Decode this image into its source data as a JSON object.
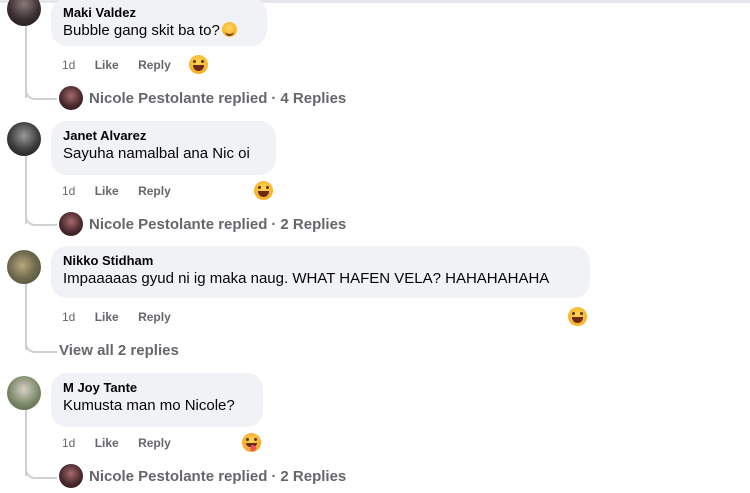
{
  "comments": [
    {
      "author": "Maki Valdez",
      "text": "Bubble gang skit ba to?",
      "time": "1d",
      "like_label": "Like",
      "reply_label": "Reply",
      "reaction_icon": "laughing-emoji-icon",
      "replies_summary": {
        "name": "Nicole Pestolante replied",
        "count": "4 Replies"
      }
    },
    {
      "author": "Janet Alvarez",
      "text": "Sayuha namalbal ana Nic oi",
      "time": "1d",
      "like_label": "Like",
      "reply_label": "Reply",
      "reaction_icon": "laughing-emoji-icon",
      "replies_summary": {
        "name": "Nicole Pestolante replied",
        "count": "2 Replies"
      }
    },
    {
      "author": "Nikko Stidham",
      "text": "Impaaaaas gyud ni ig maka naug. WHAT HAFEN VELA? HAHAHAHAHA",
      "time": "1d",
      "like_label": "Like",
      "reply_label": "Reply",
      "reaction_icon": "laughing-emoji-icon",
      "view_all": "View all 2 replies"
    },
    {
      "author": "M Joy Tante",
      "text": "Kumusta man mo Nicole?",
      "time": "1d",
      "like_label": "Like",
      "reply_label": "Reply",
      "reaction_icon": "tongue-emoji-icon",
      "replies_summary": {
        "name": "Nicole Pestolante replied",
        "count": "2 Replies"
      }
    }
  ],
  "separator": "·"
}
